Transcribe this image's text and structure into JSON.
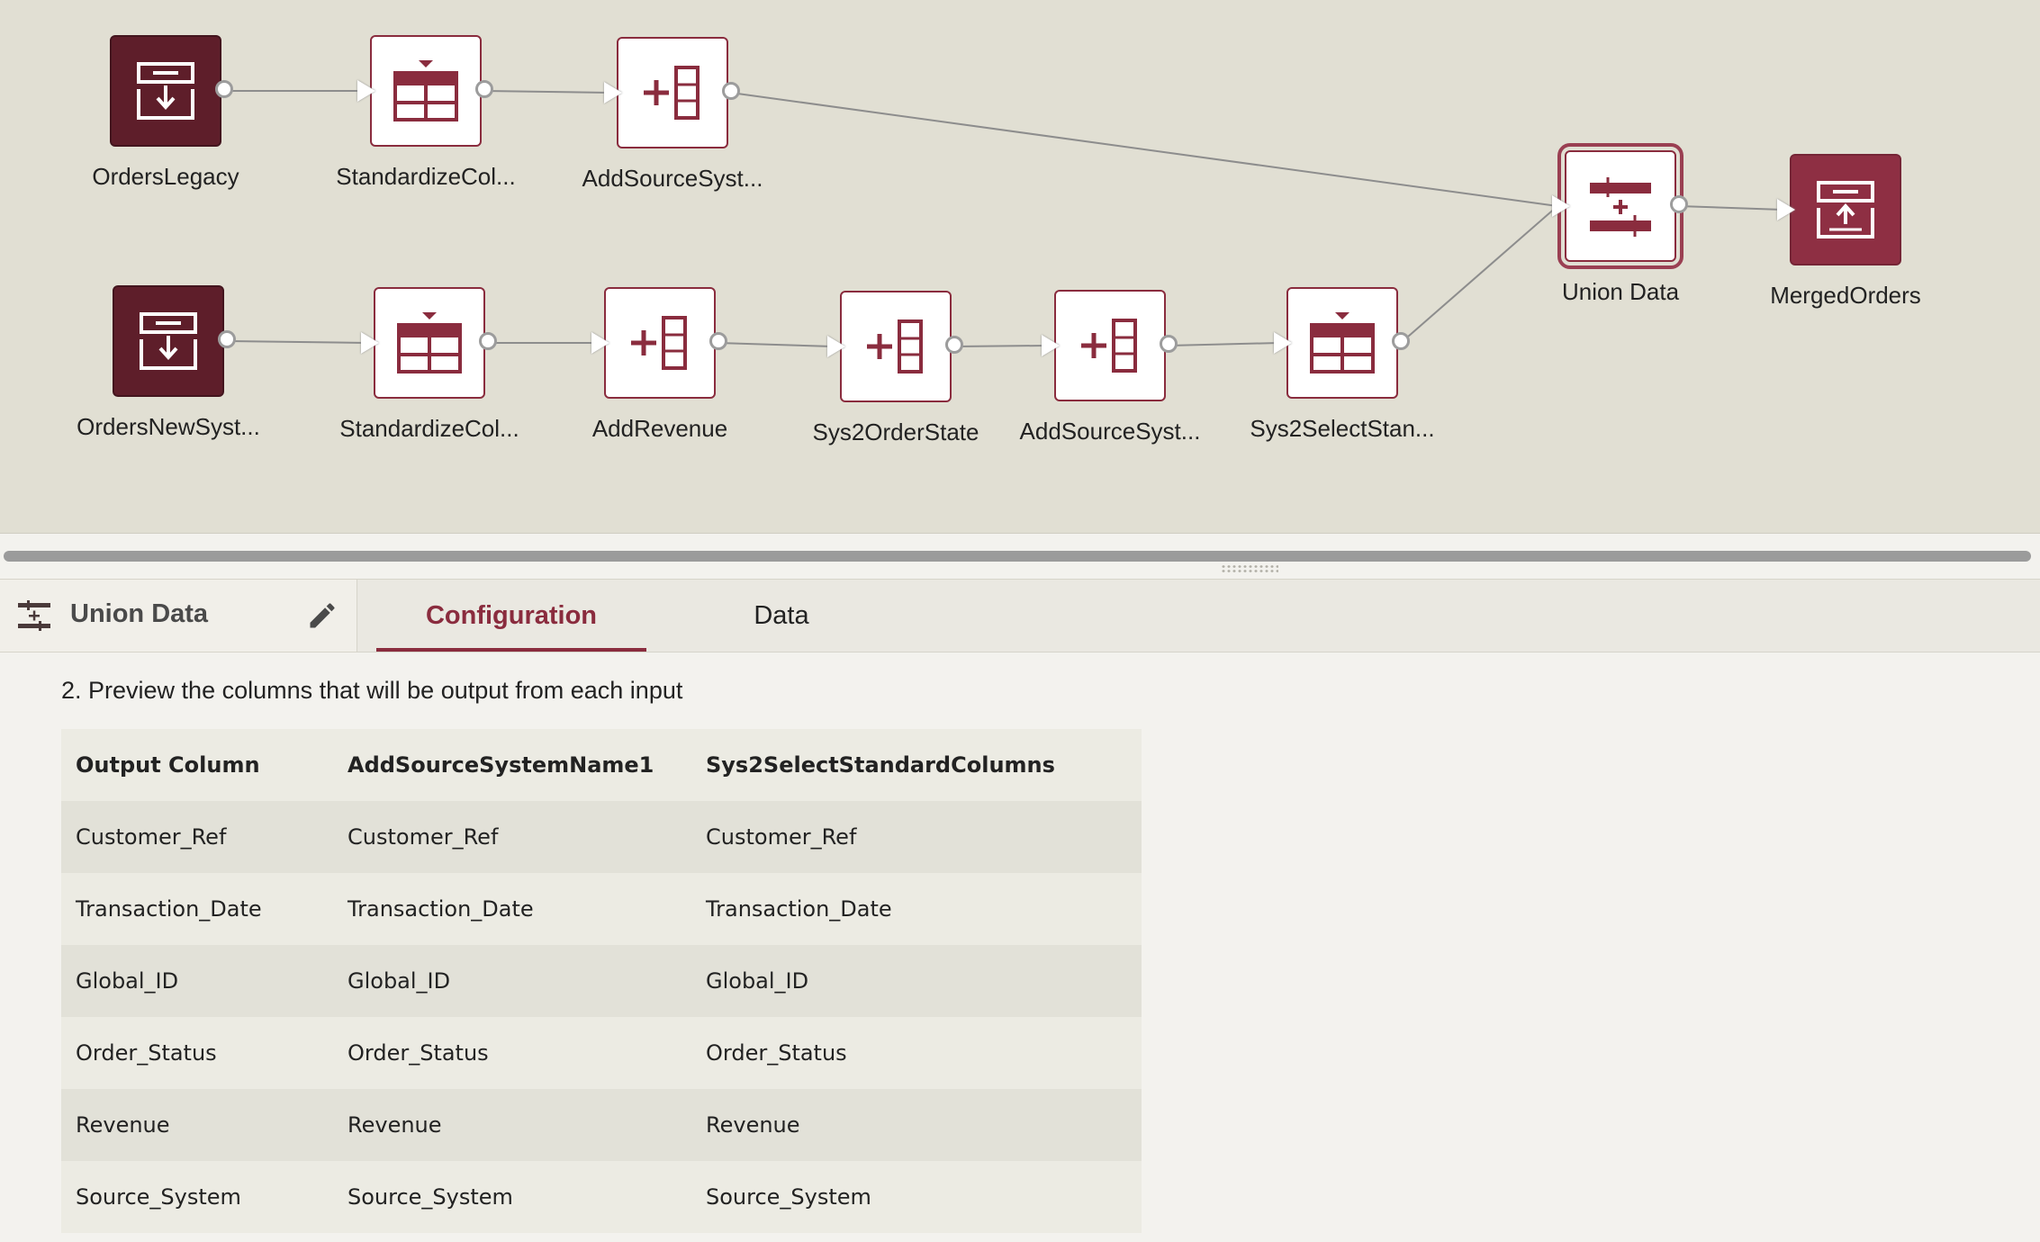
{
  "workflow": {
    "nodes": [
      {
        "id": "ordersLegacy",
        "label": "OrdersLegacy",
        "type": "source",
        "icon": "input-data-icon"
      },
      {
        "id": "stdCol1",
        "label": "StandardizeCol...",
        "type": "transform",
        "icon": "select-columns-icon"
      },
      {
        "id": "addSrc1",
        "label": "AddSourceSyst...",
        "type": "transform",
        "icon": "add-column-icon"
      },
      {
        "id": "ordersNew",
        "label": "OrdersNewSyst...",
        "type": "source",
        "icon": "input-data-icon"
      },
      {
        "id": "stdCol2",
        "label": "StandardizeCol...",
        "type": "transform",
        "icon": "select-columns-icon"
      },
      {
        "id": "addRevenue",
        "label": "AddRevenue",
        "type": "transform",
        "icon": "add-column-icon"
      },
      {
        "id": "sys2OrderState",
        "label": "Sys2OrderState",
        "type": "transform",
        "icon": "add-column-icon"
      },
      {
        "id": "addSrc2",
        "label": "AddSourceSyst...",
        "type": "transform",
        "icon": "add-column-icon"
      },
      {
        "id": "sys2Select",
        "label": "Sys2SelectStan...",
        "type": "transform",
        "icon": "select-columns-icon"
      },
      {
        "id": "unionData",
        "label": "Union Data",
        "type": "union",
        "icon": "union-icon",
        "selected": true
      },
      {
        "id": "mergedOrders",
        "label": "MergedOrders",
        "type": "target",
        "icon": "output-data-icon"
      }
    ],
    "edges": [
      [
        "ordersLegacy",
        "stdCol1"
      ],
      [
        "stdCol1",
        "addSrc1"
      ],
      [
        "addSrc1",
        "unionData"
      ],
      [
        "ordersNew",
        "stdCol2"
      ],
      [
        "stdCol2",
        "addRevenue"
      ],
      [
        "addRevenue",
        "sys2OrderState"
      ],
      [
        "sys2OrderState",
        "addSrc2"
      ],
      [
        "addSrc2",
        "sys2Select"
      ],
      [
        "sys2Select",
        "unionData"
      ],
      [
        "unionData",
        "mergedOrders"
      ]
    ]
  },
  "panel": {
    "node_title": "Union Data",
    "tabs": {
      "configuration": "Configuration",
      "data": "Data"
    },
    "active_tab": "Configuration",
    "step_text": "2. Preview the columns that will be output from each input",
    "table": {
      "headers": [
        "Output Column",
        "AddSourceSystemName1",
        "Sys2SelectStandardColumns"
      ],
      "rows": [
        [
          "Customer_Ref",
          "Customer_Ref",
          "Customer_Ref"
        ],
        [
          "Transaction_Date",
          "Transaction_Date",
          "Transaction_Date"
        ],
        [
          "Global_ID",
          "Global_ID",
          "Global_ID"
        ],
        [
          "Order_Status",
          "Order_Status",
          "Order_Status"
        ],
        [
          "Revenue",
          "Revenue",
          "Revenue"
        ],
        [
          "Source_System",
          "Source_System",
          "Source_System"
        ]
      ]
    }
  },
  "colors": {
    "accent": "#8a2c3e",
    "source": "#5e1e2a",
    "target": "#8e2f43",
    "canvas": "#e1dfd3"
  }
}
